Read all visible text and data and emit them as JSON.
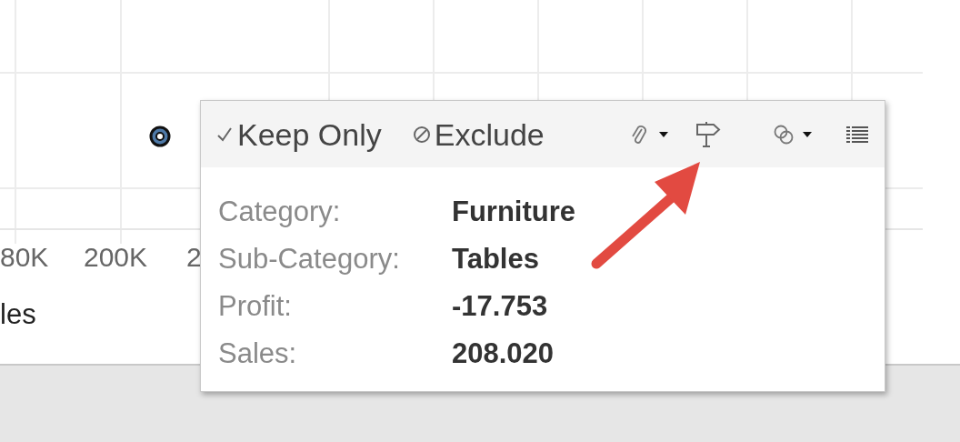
{
  "chart": {
    "axis_labels": [
      "80K",
      "200K",
      "2"
    ],
    "axis_title": "les"
  },
  "tooltip": {
    "actions": [
      {
        "kind": "keep",
        "label": "Keep Only"
      },
      {
        "kind": "exclude",
        "label": "Exclude"
      }
    ],
    "fields": [
      {
        "label": "Category:",
        "value": "Furniture"
      },
      {
        "label": "Sub-Category:",
        "value": "Tables"
      },
      {
        "label": "Profit:",
        "value": "-17.753"
      },
      {
        "label": "Sales:",
        "value": "208.020"
      }
    ]
  }
}
